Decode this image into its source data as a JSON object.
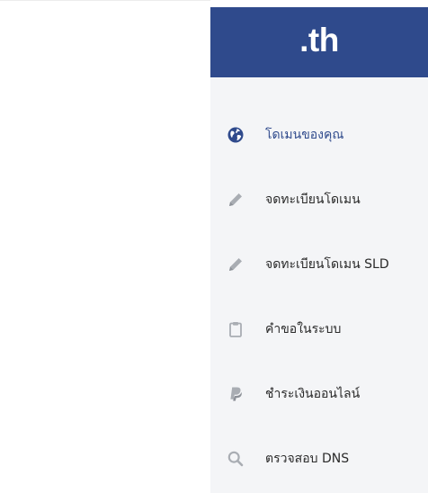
{
  "brand": {
    "logo_text": ".th"
  },
  "colors": {
    "header_bg": "#2f4a8c",
    "sidebar_bg": "#f4f5f7",
    "active_icon": "#2f4a8c",
    "inactive_icon": "#a9adb3"
  },
  "menu": {
    "items": [
      {
        "label": "โดเมนของคุณ",
        "icon": "globe-icon",
        "active": true
      },
      {
        "label": "จดทะเบียนโดเมน",
        "icon": "pencil-icon",
        "active": false
      },
      {
        "label": "จดทะเบียนโดเมน SLD",
        "icon": "pencil-icon",
        "active": false
      },
      {
        "label": "คำขอในระบบ",
        "icon": "clipboard-icon",
        "active": false
      },
      {
        "label": "ชำระเงินออนไลน์",
        "icon": "paypal-icon",
        "active": false
      },
      {
        "label": "ตรวจสอบ DNS",
        "icon": "search-icon",
        "active": false
      }
    ]
  }
}
